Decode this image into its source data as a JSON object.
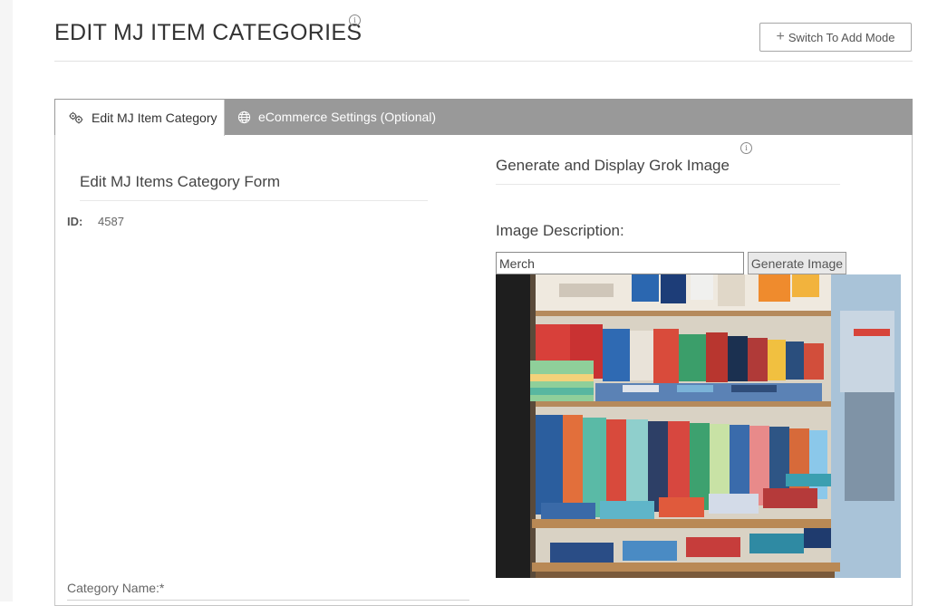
{
  "header": {
    "title": "EDIT MJ ITEM CATEGORIES",
    "info_icon": "info-icon",
    "switch_button_label": "Switch To Add Mode"
  },
  "tabs": [
    {
      "label": "Edit MJ Item Category",
      "icon": "gears-icon",
      "active": true
    },
    {
      "label": "eCommerce Settings (Optional)",
      "icon": "globe-icon",
      "active": false
    }
  ],
  "form": {
    "title": "Edit MJ Items Category Form",
    "id_label": "ID:",
    "id_value": "4587",
    "category_name_label": "Category Name:*"
  },
  "image_generator": {
    "title": "Generate and Display Grok Image",
    "description_label": "Image Description:",
    "description_value": "Merch",
    "generate_button_label": "Generate Image",
    "image_alt": "Clothing store shelves with folded t-shirts and hanging shirts"
  },
  "colors": {
    "tab_bar": "#999999",
    "accent_text": "#333333"
  }
}
